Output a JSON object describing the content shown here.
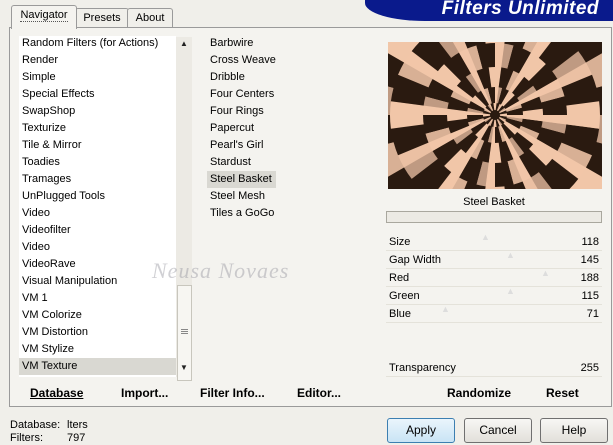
{
  "tabs": [
    {
      "label": "Navigator"
    },
    {
      "label": "Presets"
    },
    {
      "label": "About"
    }
  ],
  "banner": {
    "title": "Filters Unlimited"
  },
  "categories": [
    "Random Filters (for Actions)",
    "Render",
    "Simple",
    "Special Effects",
    "SwapShop",
    "Texturize",
    "Tile & Mirror",
    "Toadies",
    "Tramages",
    "UnPlugged Tools",
    "Video",
    "Videofilter",
    "Video",
    "VideoRave",
    "Visual Manipulation",
    "VM 1",
    "VM Colorize",
    "VM Distortion",
    "VM Stylize",
    "VM Texture"
  ],
  "selected_category": "VM Texture",
  "filters": [
    "Barbwire",
    "Cross Weave",
    "Dribble",
    "Four Centers",
    "Four Rings",
    "Papercut",
    "Pearl's Girl",
    "Stardust",
    "Steel Basket",
    "Steel Mesh",
    "Tiles a GoGo"
  ],
  "selected_filter": "Steel Basket",
  "preview": {
    "filter_name": "Steel Basket"
  },
  "parameters": [
    {
      "label": "Size",
      "value": "118"
    },
    {
      "label": "Gap Width",
      "value": "145"
    },
    {
      "label": "Red",
      "value": "188"
    },
    {
      "label": "Green",
      "value": "115"
    },
    {
      "label": "Blue",
      "value": "71"
    }
  ],
  "transparency": {
    "label": "Transparency",
    "value": "255"
  },
  "toolbar": {
    "database": "Database",
    "import": "Import...",
    "filter_info": "Filter Info...",
    "editor": "Editor...",
    "randomize": "Randomize",
    "reset": "Reset"
  },
  "footer": {
    "database_label": "Database:",
    "database_value": "lters",
    "filters_label": "Filters:",
    "filters_value": "797"
  },
  "buttons": {
    "apply": "Apply",
    "cancel": "Cancel",
    "help": "Help"
  },
  "watermark": "Neusa Novaes",
  "colors": {
    "banner": "#0a1a8c",
    "preview_light": "#f1c6a8",
    "preview_dark": "#2a1a10"
  }
}
